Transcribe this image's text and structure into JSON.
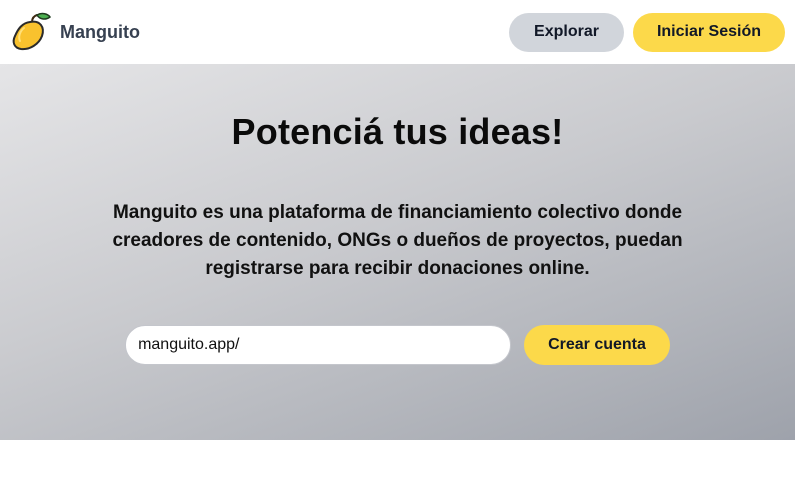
{
  "navbar": {
    "brand_name": "Manguito",
    "logo_icon": "mango-icon",
    "explore_label": "Explorar",
    "login_label": "Iniciar Sesión"
  },
  "hero": {
    "title": "Potenciá tus ideas!",
    "description": "Manguito es una plataforma de financiamiento colectivo donde creadores de contenido, ONGs o dueños de proyectos, puedan registrarse para recibir donaciones online.",
    "url_value": "manguito.app/",
    "create_label": "Crear cuenta"
  },
  "colors": {
    "accent_yellow": "#fcd94a",
    "secondary_gray": "#d1d5db",
    "brand_text": "#374151"
  }
}
